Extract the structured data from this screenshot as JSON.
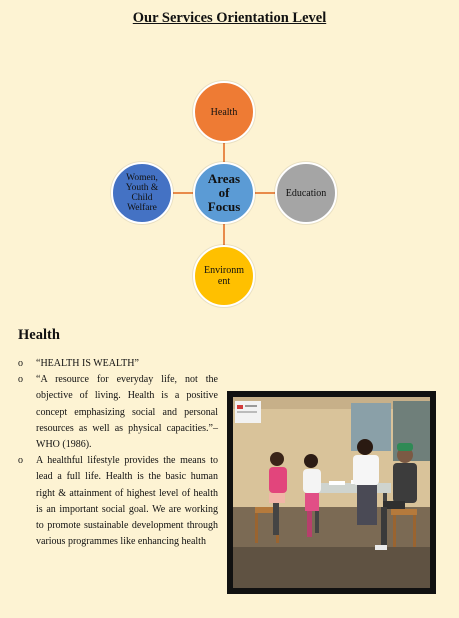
{
  "title": "Our Services Orientation Level",
  "diagram": {
    "center": "Areas of Focus",
    "top": "Health",
    "left": "Women, Youth & Child Welfare",
    "right": "Education",
    "bottom": "Environment"
  },
  "section": {
    "heading": "Health",
    "bullets": [
      "“HEALTH IS WEALTH”",
      "“A resource for everyday life, not the objective of living. Health is a positive concept emphasizing social and personal resources as well as physical capacities.”–WHO (1986).",
      "A healthful lifestyle provides the means to lead a full life. Health is the basic human right & attainment of highest level of health is an important social goal. We are working to promote sustainable development through various programmes like enhancing health"
    ],
    "bullet_marker": "o"
  },
  "colors": {
    "background": "#fdf3d3",
    "health": "#ee7b34",
    "center": "#5b9bd5",
    "women": "#4472c4",
    "education": "#a5a5a5",
    "environment": "#ffc000"
  }
}
